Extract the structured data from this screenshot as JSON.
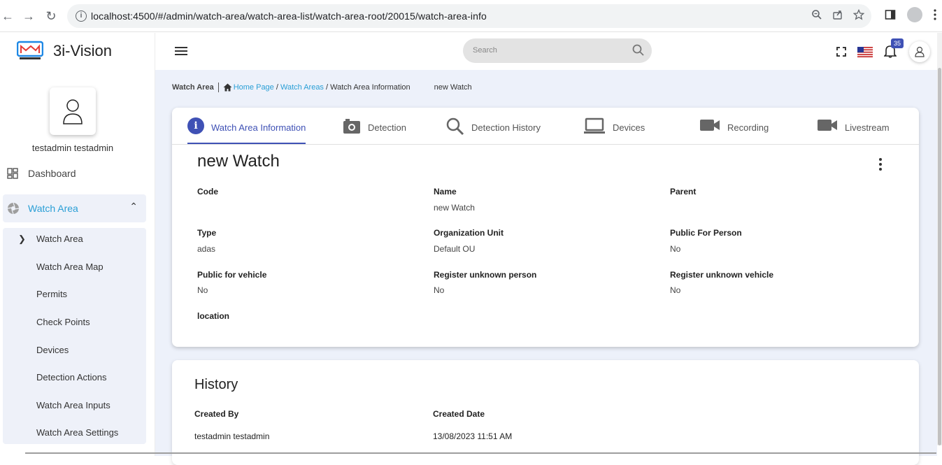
{
  "browser": {
    "url": "localhost:4500/#/admin/watch-area/watch-area-list/watch-area-root/20015/watch-area-info"
  },
  "sidebar": {
    "brand": "3i-Vision",
    "user_name": "testadmin testadmin",
    "dashboard_label": "Dashboard",
    "watch_area_label": "Watch Area",
    "submenu": [
      "Watch Area",
      "Watch Area Map",
      "Permits",
      "Check Points",
      "Devices",
      "Detection Actions",
      "Watch Area Inputs",
      "Watch Area Settings"
    ]
  },
  "topbar": {
    "search_placeholder": "Search",
    "notification_count": "35"
  },
  "breadcrumb": {
    "title": "Watch Area",
    "home": "Home Page",
    "watch_areas": "Watch Areas",
    "current": "Watch Area Information",
    "extra": "new Watch"
  },
  "tabs": [
    "Watch Area Information",
    "Detection",
    "Detection History",
    "Devices",
    "Recording",
    "Livestream"
  ],
  "info": {
    "title": "new Watch",
    "fields": {
      "code": {
        "label": "Code",
        "value": ""
      },
      "name": {
        "label": "Name",
        "value": "new Watch"
      },
      "parent": {
        "label": "Parent",
        "value": ""
      },
      "type": {
        "label": "Type",
        "value": "adas"
      },
      "org_unit": {
        "label": "Organization Unit",
        "value": "Default OU"
      },
      "public_person": {
        "label": "Public For Person",
        "value": "No"
      },
      "public_vehicle": {
        "label": "Public for vehicle",
        "value": "No"
      },
      "reg_person": {
        "label": "Register unknown person",
        "value": "No"
      },
      "reg_vehicle": {
        "label": "Register unknown vehicle",
        "value": "No"
      },
      "location": {
        "label": "location",
        "value": ""
      }
    }
  },
  "history": {
    "title": "History",
    "created_by": {
      "label": "Created By",
      "value": "testadmin testadmin"
    },
    "created_date": {
      "label": "Created Date",
      "value": "13/08/2023 11:51 AM"
    }
  },
  "colors": {
    "primary": "#3f51b5",
    "link": "#2a9fd6",
    "sidebar_active_bg": "#eef1f9",
    "content_bg": "#edf1fa"
  }
}
